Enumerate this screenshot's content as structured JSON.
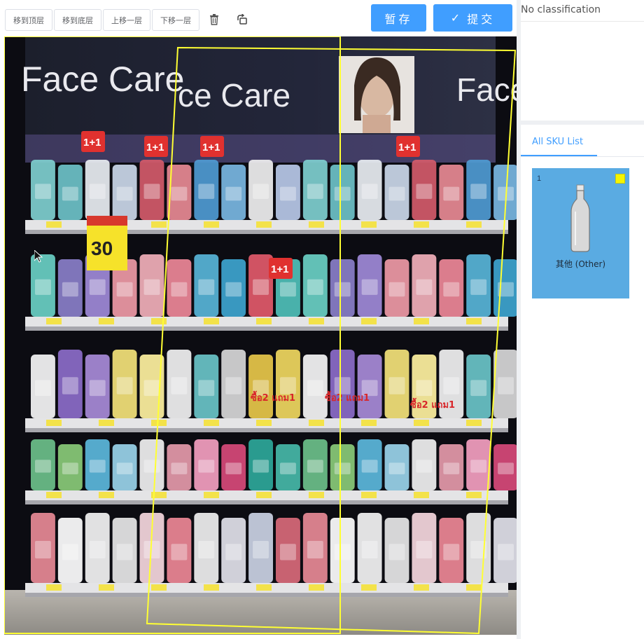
{
  "toolbar": {
    "bring_to_top": "移到顶层",
    "send_to_bottom": "移到底层",
    "move_up": "上移一层",
    "move_down": "下移一层",
    "delete_icon": "trash-icon",
    "rotate_icon": "rotate-icon",
    "save": "暂存",
    "submit_check": "✓",
    "submit": "提交"
  },
  "photo": {
    "signs": [
      "Face Care",
      "ce Care",
      "Face"
    ],
    "promo_price": "30",
    "promo_tags": [
      "1+1",
      "1+1",
      "1+1",
      "1+1",
      "1+1"
    ],
    "deal_labels": [
      "ซื้อ2 แถม1",
      "ซื้อ2 แถม1",
      "ซื้อ2 แถม1"
    ],
    "selection_color": "#ffff33"
  },
  "panel": {
    "classification": "No classification",
    "tab_label": "All SKU List"
  },
  "sku": {
    "index": "1",
    "name": "其他 (Other)",
    "swatch_color": "#f5f500",
    "card_color": "#5aabe2"
  }
}
